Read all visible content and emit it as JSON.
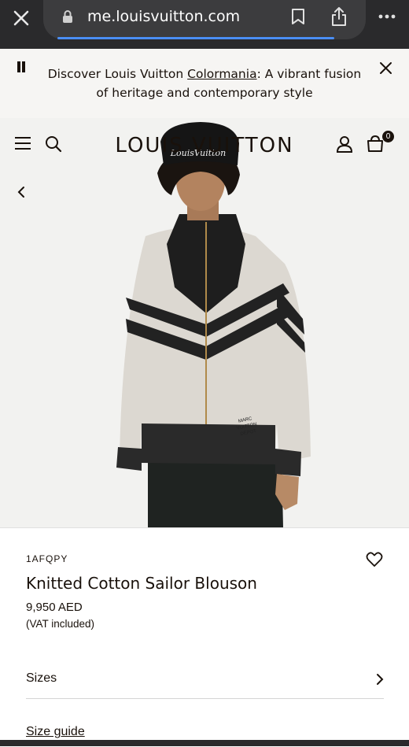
{
  "browser": {
    "url": "me.louisvuitton.com",
    "icons": [
      "close-icon",
      "lock-icon",
      "bookmark-icon",
      "share-icon",
      "more-icon"
    ]
  },
  "banner": {
    "text_before": "Discover Louis Vuitton ",
    "link": "Colormania",
    "text_after": ": A vibrant fusion of heritage and contemporary style"
  },
  "header": {
    "logo": "LOUIS VUITTON",
    "bag_count": "0"
  },
  "product": {
    "sku": "1AFQPY",
    "name": "Knitted Cotton Sailor Blouson",
    "price": "9,950 AED",
    "vat": "(VAT included)",
    "sizes_label": "Sizes",
    "size_guide": "Size guide",
    "image_description_colors": {
      "ecru": "#dcd8d1",
      "black": "#1c1c1c"
    },
    "jacket_print": "MARC VUITTON DÉPOT"
  }
}
